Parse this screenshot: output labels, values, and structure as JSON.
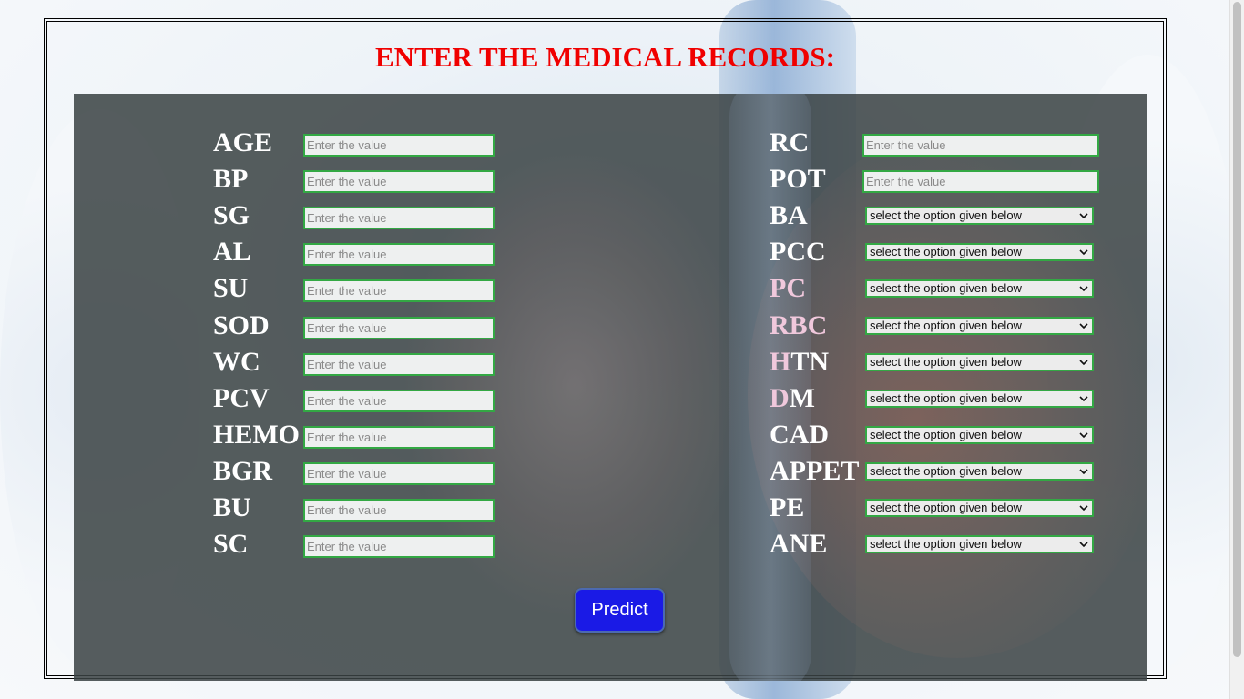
{
  "page": {
    "title": "ENTER THE MEDICAL RECORDS:"
  },
  "form": {
    "left_fields": [
      {
        "label": "AGE",
        "placeholder": "Enter the value"
      },
      {
        "label": "BP",
        "placeholder": "Enter the value"
      },
      {
        "label": "SG",
        "placeholder": "Enter the value"
      },
      {
        "label": "AL",
        "placeholder": "Enter the value"
      },
      {
        "label": "SU",
        "placeholder": "Enter the value"
      },
      {
        "label": "SOD",
        "placeholder": "Enter the value"
      },
      {
        "label": "WC",
        "placeholder": "Enter the value"
      },
      {
        "label": "PCV",
        "placeholder": "Enter the value"
      },
      {
        "label": "HEMO",
        "placeholder": "Enter the value"
      },
      {
        "label": "BGR",
        "placeholder": "Enter the value"
      },
      {
        "label": "BU",
        "placeholder": "Enter the value"
      },
      {
        "label": "SC",
        "placeholder": "Enter the value"
      }
    ],
    "right_inputs": [
      {
        "label": "RC",
        "placeholder": "Enter the value"
      },
      {
        "label": "POT",
        "placeholder": "Enter the value"
      }
    ],
    "right_selects": [
      {
        "label": "BA",
        "selected": "select the option given below"
      },
      {
        "label": "PCC",
        "selected": "select the option given below"
      },
      {
        "label": "PC",
        "selected": "select the option given below"
      },
      {
        "label": "RBC",
        "selected": "select the option given below"
      },
      {
        "label": "HTN",
        "selected": "select the option given below"
      },
      {
        "label": "DM",
        "selected": "select the option given below"
      },
      {
        "label": "CAD",
        "selected": "select the option given below"
      },
      {
        "label": "APPET",
        "selected": "select the option given below"
      },
      {
        "label": "PE",
        "selected": "select the option given below"
      },
      {
        "label": "ANE",
        "selected": "select the option given below"
      }
    ],
    "submit_label": "Predict"
  },
  "colors": {
    "title": "#f00000",
    "panel": "#3a4244",
    "input_border": "#33a844",
    "button": "#1a1ae6"
  }
}
